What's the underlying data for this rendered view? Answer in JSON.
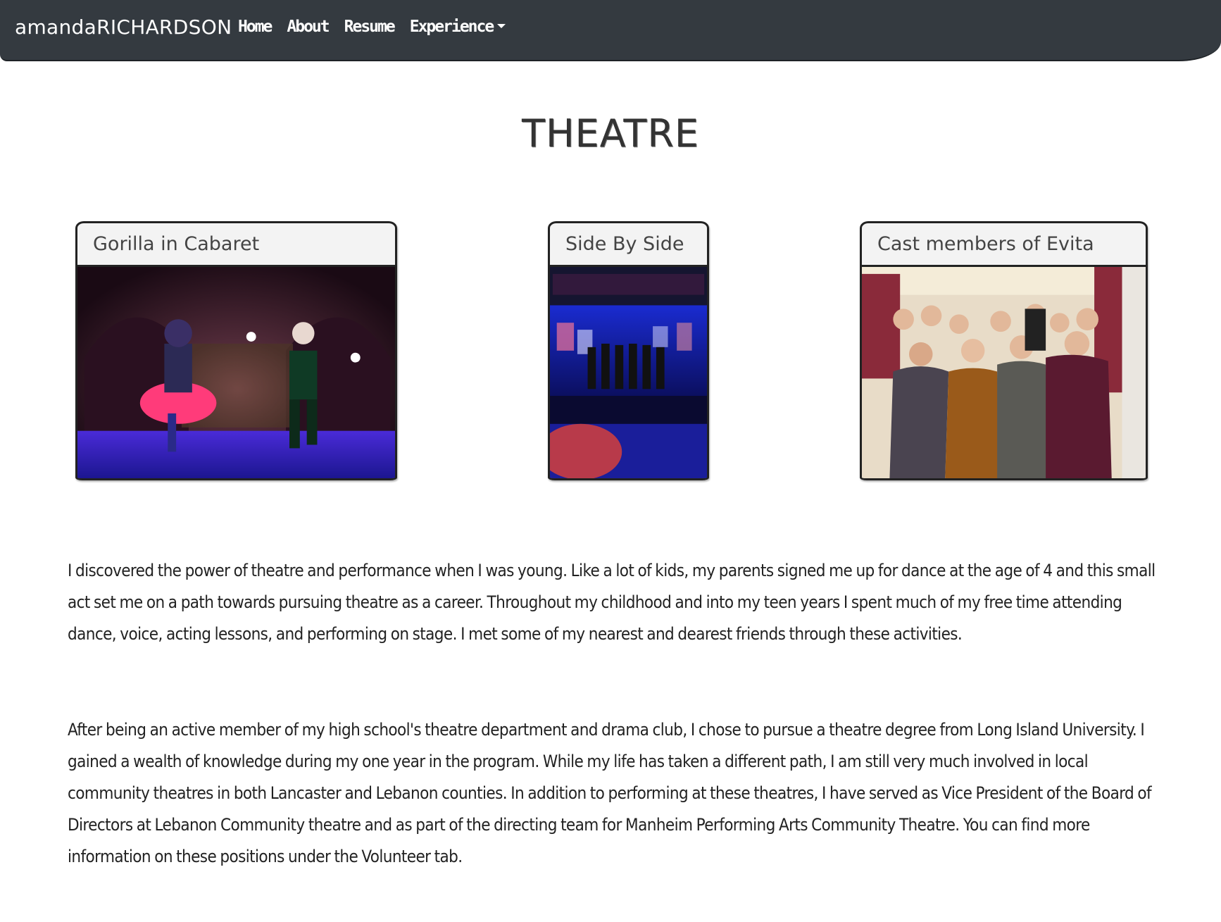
{
  "navbar": {
    "brand": "amandaRICHARDSON",
    "links": [
      "Home",
      "About",
      "Resume",
      "Experience"
    ]
  },
  "page_title": "THEATRE",
  "cards": [
    {
      "title": "Gorilla in Cabaret"
    },
    {
      "title": "Side By Side"
    },
    {
      "title": "Cast members of Evita"
    }
  ],
  "paragraphs": [
    "I discovered the power of theatre and performance when I was young. Like a lot of kids, my parents signed me up for dance at the age of 4 and this small act set me on a path towards pursuing theatre as a career. Throughout my childhood and into my teen years I spent much of my free time attending dance, voice, acting lessons, and performing on stage. I met some of my nearest and dearest friends through these activities.",
    "After being an active member of my high school's theatre department and drama club, I chose to pursue a theatre degree from Long Island University. I gained a wealth of knowledge during my one year in the program. While my life has taken a different path, I am still very much involved in local community theatres in both Lancaster and Lebanon counties. In addition to performing at these theatres, I have served as Vice President of the Board of Directors at Lebanon Community theatre and as part of the directing team for Manheim Performing Arts Community Theatre. You can find more information on these positions under the Volunteer tab."
  ],
  "colors": {
    "navbar_bg": "#343a40",
    "text": "#222222"
  }
}
